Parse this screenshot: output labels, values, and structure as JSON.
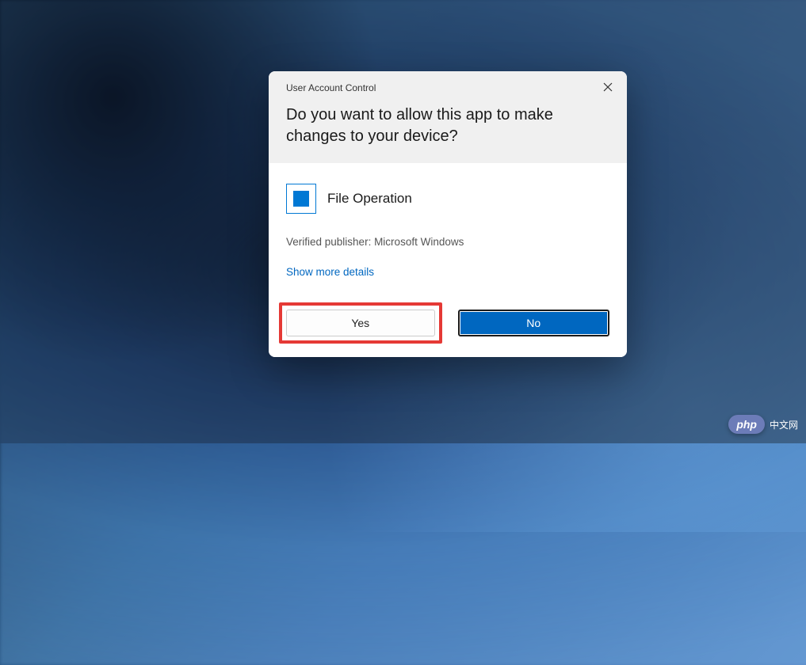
{
  "dialog": {
    "title": "User Account Control",
    "question": "Do you want to allow this app to make changes to your device?",
    "app_name": "File Operation",
    "publisher_line": "Verified publisher: Microsoft Windows",
    "show_more": "Show more details",
    "yes_label": "Yes",
    "no_label": "No"
  },
  "watermark": {
    "logo": "php",
    "text": "中文网"
  },
  "colors": {
    "accent": "#0067c0",
    "highlight_border": "#e53935"
  }
}
